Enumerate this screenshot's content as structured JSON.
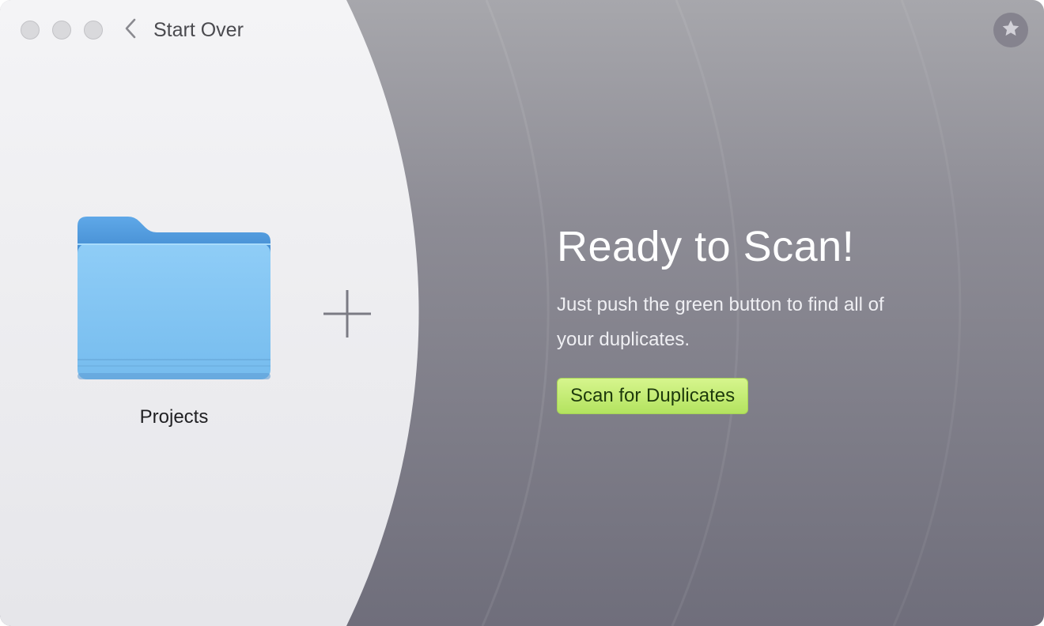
{
  "window": {
    "controls": [
      "close",
      "minimize",
      "zoom"
    ]
  },
  "nav": {
    "back_label": "Start Over",
    "back_icon": "chevron-left-icon"
  },
  "source": {
    "folder_icon": "folder-icon",
    "folder_name": "Projects",
    "add_icon": "plus-icon"
  },
  "header": {
    "favorite_icon": "star-icon"
  },
  "main": {
    "headline": "Ready to Scan!",
    "subtext": "Just push the green button to find all of your duplicates.",
    "scan_button_label": "Scan for Duplicates"
  },
  "colors": {
    "scan_button": "#c4ec77",
    "folder_blue": "#7ec3f3",
    "folder_tab": "#4a96d8",
    "left_pane": "#f2f2f5",
    "right_pane": "#7e7d89"
  }
}
